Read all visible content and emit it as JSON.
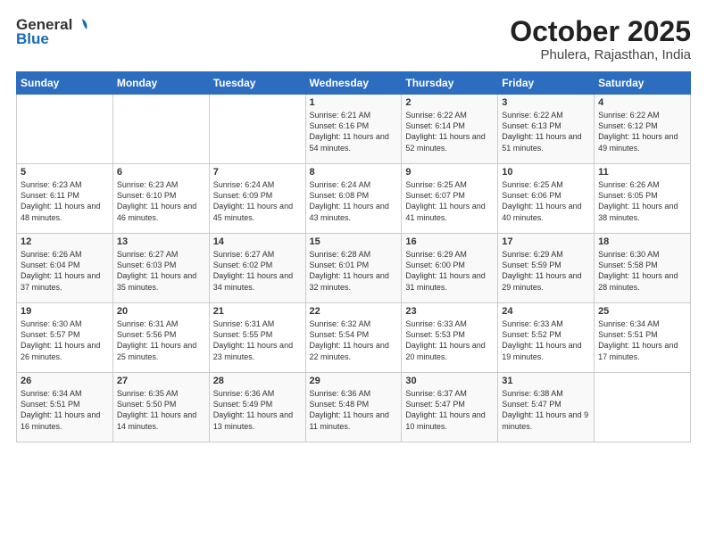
{
  "logo": {
    "line1": "General",
    "line2": "Blue"
  },
  "title": "October 2025",
  "location": "Phulera, Rajasthan, India",
  "days_header": [
    "Sunday",
    "Monday",
    "Tuesday",
    "Wednesday",
    "Thursday",
    "Friday",
    "Saturday"
  ],
  "weeks": [
    [
      {
        "day": "",
        "sunrise": "",
        "sunset": "",
        "daylight": ""
      },
      {
        "day": "",
        "sunrise": "",
        "sunset": "",
        "daylight": ""
      },
      {
        "day": "",
        "sunrise": "",
        "sunset": "",
        "daylight": ""
      },
      {
        "day": "1",
        "sunrise": "Sunrise: 6:21 AM",
        "sunset": "Sunset: 6:16 PM",
        "daylight": "Daylight: 11 hours and 54 minutes."
      },
      {
        "day": "2",
        "sunrise": "Sunrise: 6:22 AM",
        "sunset": "Sunset: 6:14 PM",
        "daylight": "Daylight: 11 hours and 52 minutes."
      },
      {
        "day": "3",
        "sunrise": "Sunrise: 6:22 AM",
        "sunset": "Sunset: 6:13 PM",
        "daylight": "Daylight: 11 hours and 51 minutes."
      },
      {
        "day": "4",
        "sunrise": "Sunrise: 6:22 AM",
        "sunset": "Sunset: 6:12 PM",
        "daylight": "Daylight: 11 hours and 49 minutes."
      }
    ],
    [
      {
        "day": "5",
        "sunrise": "Sunrise: 6:23 AM",
        "sunset": "Sunset: 6:11 PM",
        "daylight": "Daylight: 11 hours and 48 minutes."
      },
      {
        "day": "6",
        "sunrise": "Sunrise: 6:23 AM",
        "sunset": "Sunset: 6:10 PM",
        "daylight": "Daylight: 11 hours and 46 minutes."
      },
      {
        "day": "7",
        "sunrise": "Sunrise: 6:24 AM",
        "sunset": "Sunset: 6:09 PM",
        "daylight": "Daylight: 11 hours and 45 minutes."
      },
      {
        "day": "8",
        "sunrise": "Sunrise: 6:24 AM",
        "sunset": "Sunset: 6:08 PM",
        "daylight": "Daylight: 11 hours and 43 minutes."
      },
      {
        "day": "9",
        "sunrise": "Sunrise: 6:25 AM",
        "sunset": "Sunset: 6:07 PM",
        "daylight": "Daylight: 11 hours and 41 minutes."
      },
      {
        "day": "10",
        "sunrise": "Sunrise: 6:25 AM",
        "sunset": "Sunset: 6:06 PM",
        "daylight": "Daylight: 11 hours and 40 minutes."
      },
      {
        "day": "11",
        "sunrise": "Sunrise: 6:26 AM",
        "sunset": "Sunset: 6:05 PM",
        "daylight": "Daylight: 11 hours and 38 minutes."
      }
    ],
    [
      {
        "day": "12",
        "sunrise": "Sunrise: 6:26 AM",
        "sunset": "Sunset: 6:04 PM",
        "daylight": "Daylight: 11 hours and 37 minutes."
      },
      {
        "day": "13",
        "sunrise": "Sunrise: 6:27 AM",
        "sunset": "Sunset: 6:03 PM",
        "daylight": "Daylight: 11 hours and 35 minutes."
      },
      {
        "day": "14",
        "sunrise": "Sunrise: 6:27 AM",
        "sunset": "Sunset: 6:02 PM",
        "daylight": "Daylight: 11 hours and 34 minutes."
      },
      {
        "day": "15",
        "sunrise": "Sunrise: 6:28 AM",
        "sunset": "Sunset: 6:01 PM",
        "daylight": "Daylight: 11 hours and 32 minutes."
      },
      {
        "day": "16",
        "sunrise": "Sunrise: 6:29 AM",
        "sunset": "Sunset: 6:00 PM",
        "daylight": "Daylight: 11 hours and 31 minutes."
      },
      {
        "day": "17",
        "sunrise": "Sunrise: 6:29 AM",
        "sunset": "Sunset: 5:59 PM",
        "daylight": "Daylight: 11 hours and 29 minutes."
      },
      {
        "day": "18",
        "sunrise": "Sunrise: 6:30 AM",
        "sunset": "Sunset: 5:58 PM",
        "daylight": "Daylight: 11 hours and 28 minutes."
      }
    ],
    [
      {
        "day": "19",
        "sunrise": "Sunrise: 6:30 AM",
        "sunset": "Sunset: 5:57 PM",
        "daylight": "Daylight: 11 hours and 26 minutes."
      },
      {
        "day": "20",
        "sunrise": "Sunrise: 6:31 AM",
        "sunset": "Sunset: 5:56 PM",
        "daylight": "Daylight: 11 hours and 25 minutes."
      },
      {
        "day": "21",
        "sunrise": "Sunrise: 6:31 AM",
        "sunset": "Sunset: 5:55 PM",
        "daylight": "Daylight: 11 hours and 23 minutes."
      },
      {
        "day": "22",
        "sunrise": "Sunrise: 6:32 AM",
        "sunset": "Sunset: 5:54 PM",
        "daylight": "Daylight: 11 hours and 22 minutes."
      },
      {
        "day": "23",
        "sunrise": "Sunrise: 6:33 AM",
        "sunset": "Sunset: 5:53 PM",
        "daylight": "Daylight: 11 hours and 20 minutes."
      },
      {
        "day": "24",
        "sunrise": "Sunrise: 6:33 AM",
        "sunset": "Sunset: 5:52 PM",
        "daylight": "Daylight: 11 hours and 19 minutes."
      },
      {
        "day": "25",
        "sunrise": "Sunrise: 6:34 AM",
        "sunset": "Sunset: 5:51 PM",
        "daylight": "Daylight: 11 hours and 17 minutes."
      }
    ],
    [
      {
        "day": "26",
        "sunrise": "Sunrise: 6:34 AM",
        "sunset": "Sunset: 5:51 PM",
        "daylight": "Daylight: 11 hours and 16 minutes."
      },
      {
        "day": "27",
        "sunrise": "Sunrise: 6:35 AM",
        "sunset": "Sunset: 5:50 PM",
        "daylight": "Daylight: 11 hours and 14 minutes."
      },
      {
        "day": "28",
        "sunrise": "Sunrise: 6:36 AM",
        "sunset": "Sunset: 5:49 PM",
        "daylight": "Daylight: 11 hours and 13 minutes."
      },
      {
        "day": "29",
        "sunrise": "Sunrise: 6:36 AM",
        "sunset": "Sunset: 5:48 PM",
        "daylight": "Daylight: 11 hours and 11 minutes."
      },
      {
        "day": "30",
        "sunrise": "Sunrise: 6:37 AM",
        "sunset": "Sunset: 5:47 PM",
        "daylight": "Daylight: 11 hours and 10 minutes."
      },
      {
        "day": "31",
        "sunrise": "Sunrise: 6:38 AM",
        "sunset": "Sunset: 5:47 PM",
        "daylight": "Daylight: 11 hours and 9 minutes."
      },
      {
        "day": "",
        "sunrise": "",
        "sunset": "",
        "daylight": ""
      }
    ]
  ]
}
